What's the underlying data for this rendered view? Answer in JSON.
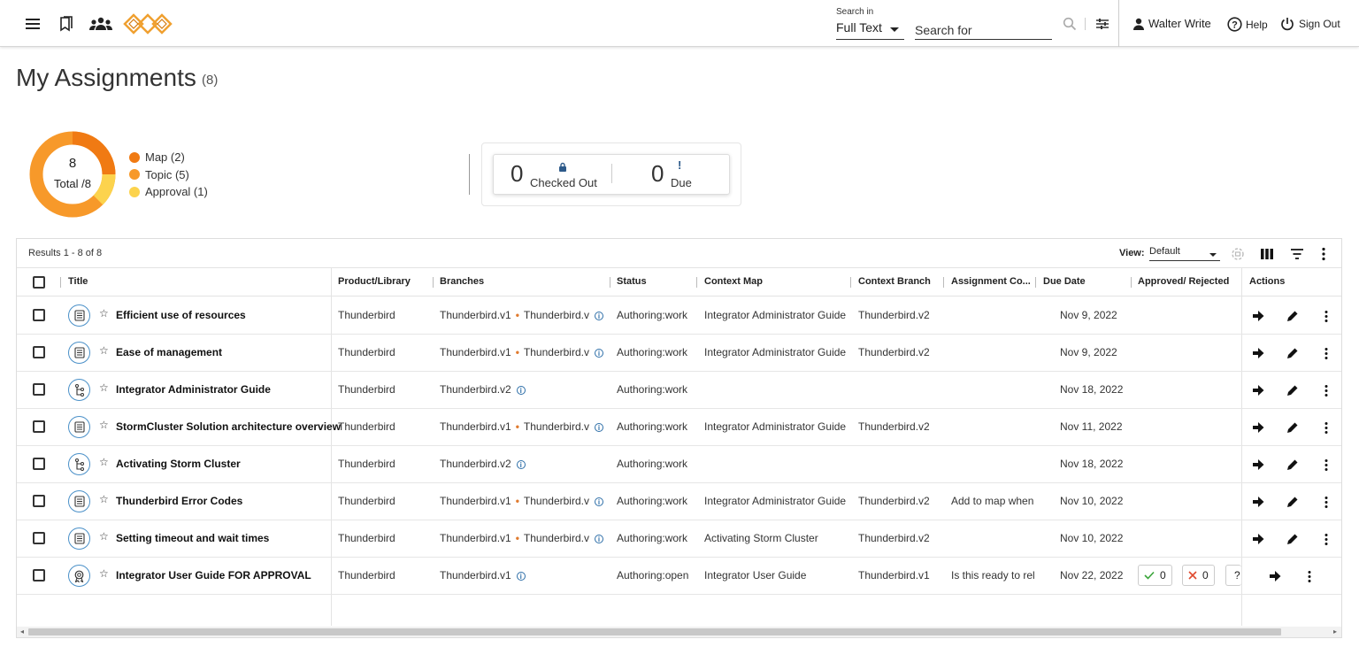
{
  "topbar": {
    "search_in_label": "Search in",
    "search_in_value": "Full Text",
    "search_placeholder": "Search for",
    "user_name": "Walter Write",
    "help_label": "Help",
    "signout_label": "Sign Out"
  },
  "page": {
    "title": "My Assignments",
    "count": "(8)"
  },
  "summary": {
    "total_num": "8",
    "total_label": "Total /8",
    "legend": [
      {
        "label": "Map (2)",
        "color": "#f07a13"
      },
      {
        "label": "Topic (5)",
        "color": "#f7992a"
      },
      {
        "label": "Approval (1)",
        "color": "#fcd34d"
      }
    ],
    "checked_out_num": "0",
    "checked_out_label": "Checked Out",
    "due_num": "0",
    "due_label": "Due"
  },
  "grid": {
    "results_label": "Results 1 - 8 of 8",
    "view_label": "View:",
    "view_value": "Default",
    "columns": [
      "Title",
      "Product/Library",
      "Branches",
      "Status",
      "Context Map",
      "Context Branch",
      "Assignment Co...",
      "Due Date",
      "Approved/ Rejected",
      "Actions"
    ],
    "rows": [
      {
        "type": "topic",
        "title": "Efficient use of resources",
        "product": "Thunderbird",
        "branch_a": "Thunderbird.v1",
        "branch_b": "Thunderbird.v",
        "status": "Authoring:work",
        "context_map": "Integrator Administrator Guide",
        "context_branch": "Thunderbird.v2",
        "assignment_comment": "",
        "due": "Nov 9, 2022"
      },
      {
        "type": "topic",
        "title": "Ease of management",
        "product": "Thunderbird",
        "branch_a": "Thunderbird.v1",
        "branch_b": "Thunderbird.v",
        "status": "Authoring:work",
        "context_map": "Integrator Administrator Guide",
        "context_branch": "Thunderbird.v2",
        "assignment_comment": "",
        "due": "Nov 9, 2022"
      },
      {
        "type": "map",
        "title": "Integrator Administrator Guide",
        "product": "Thunderbird",
        "branch_a": "Thunderbird.v2",
        "branch_b": "",
        "status": "Authoring:work",
        "context_map": "",
        "context_branch": "",
        "assignment_comment": "",
        "due": "Nov 18, 2022"
      },
      {
        "type": "topic",
        "title": "StormCluster Solution architecture overview",
        "product": "Thunderbird",
        "branch_a": "Thunderbird.v1",
        "branch_b": "Thunderbird.v",
        "status": "Authoring:work",
        "context_map": "Integrator Administrator Guide",
        "context_branch": "Thunderbird.v2",
        "assignment_comment": "",
        "due": "Nov 11, 2022"
      },
      {
        "type": "map",
        "title": "Activating Storm Cluster",
        "product": "Thunderbird",
        "branch_a": "Thunderbird.v2",
        "branch_b": "",
        "status": "Authoring:work",
        "context_map": "",
        "context_branch": "",
        "assignment_comment": "",
        "due": "Nov 18, 2022"
      },
      {
        "type": "topic",
        "title": "Thunderbird Error Codes",
        "product": "Thunderbird",
        "branch_a": "Thunderbird.v1",
        "branch_b": "Thunderbird.v",
        "status": "Authoring:work",
        "context_map": "Integrator Administrator Guide",
        "context_branch": "Thunderbird.v2",
        "assignment_comment": "Add to map when",
        "due": "Nov 10, 2022"
      },
      {
        "type": "topic",
        "title": "Setting timeout and wait times",
        "product": "Thunderbird",
        "branch_a": "Thunderbird.v1",
        "branch_b": "Thunderbird.v",
        "status": "Authoring:work",
        "context_map": "Activating Storm Cluster",
        "context_branch": "Thunderbird.v2",
        "assignment_comment": "",
        "due": "Nov 10, 2022"
      },
      {
        "type": "approval",
        "title": "Integrator User Guide FOR APPROVAL",
        "product": "Thunderbird",
        "branch_a": "Thunderbird.v1",
        "branch_b": "",
        "status": "Authoring:open",
        "context_map": "Integrator User Guide",
        "context_branch": "Thunderbird.v1",
        "assignment_comment": "Is this ready to rel",
        "due": "Nov 22, 2022",
        "approved": "0",
        "rejected": "0",
        "pending": "?"
      }
    ]
  },
  "colors": {
    "accent_orange": "#f07a13",
    "icon_blue": "#4a90c8"
  }
}
